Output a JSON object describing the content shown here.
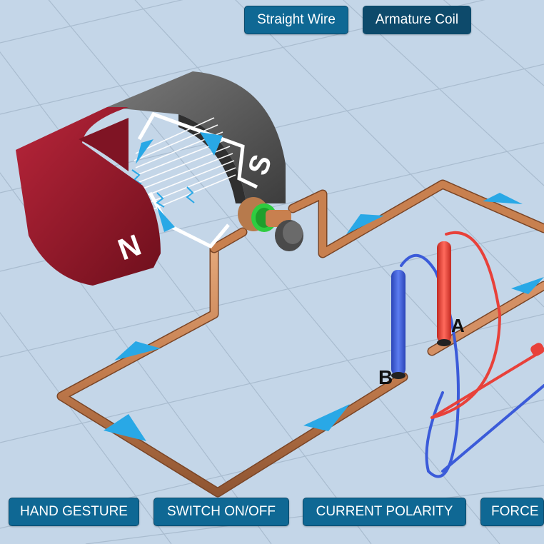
{
  "top_toggle": {
    "straight_wire": "Straight Wire",
    "armature_coil": "Armature Coil",
    "selected": "Armature Coil"
  },
  "magnet": {
    "north_label": "N",
    "south_label": "S"
  },
  "probes": {
    "a_label": "A",
    "b_label": "B"
  },
  "bottom_buttons": {
    "hand_gesture": "HAND GESTURE",
    "switch": "SWITCH ON/OFF",
    "current_polarity": "CURRENT POLARITY",
    "force": "FORCE"
  },
  "colors": {
    "background": "#c4d6e8",
    "button": "#0f6894",
    "button_active": "#0d4a6b",
    "magnet_north": "#9e1b2e",
    "magnet_south": "#5a5a5a",
    "copper_wire": "#c8804f",
    "current_arrow": "#29a8e6",
    "probe_red": "#e8413a",
    "probe_blue": "#3b5bd9",
    "commutator_ring": "#2ecc40"
  }
}
